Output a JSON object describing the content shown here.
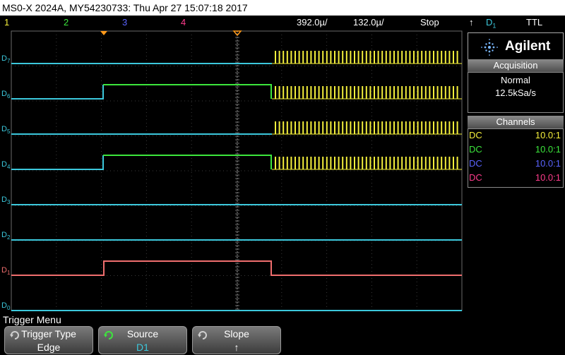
{
  "title_bar": {
    "text": "MS0-X 2024A, MY54230733: Thu Apr 27 15:07:18 2017"
  },
  "status_bar": {
    "channels": [
      {
        "label": "1",
        "color": "#f5f03c"
      },
      {
        "label": "2",
        "color": "#3ce63c"
      },
      {
        "label": "3",
        "color": "#5a64ff"
      },
      {
        "label": "4",
        "color": "#ff3c8c"
      }
    ],
    "timebase": "392.0µ/",
    "delay": "132.0µ/",
    "run_state": "Stop",
    "trigger_source": "D",
    "trigger_source_sub": "1",
    "trigger_level": "TTL"
  },
  "digital_labels": [
    {
      "name": "D",
      "sub": "7",
      "color": "#3cc8dc"
    },
    {
      "name": "D",
      "sub": "6",
      "color": "#3cc8dc"
    },
    {
      "name": "D",
      "sub": "5",
      "color": "#3cc8dc"
    },
    {
      "name": "D",
      "sub": "4",
      "color": "#3cc8dc"
    },
    {
      "name": "D",
      "sub": "3",
      "color": "#3cc8dc"
    },
    {
      "name": "D",
      "sub": "2",
      "color": "#3cc8dc"
    },
    {
      "name": "D",
      "sub": "1",
      "color": "#f06e6e"
    },
    {
      "name": "D",
      "sub": "0",
      "color": "#3cc8dc"
    }
  ],
  "brand": {
    "name": "Agilent"
  },
  "acquisition": {
    "header": "Acquisition",
    "mode": "Normal",
    "sample_rate": "12.5kSa/s"
  },
  "channels_panel": {
    "header": "Channels",
    "rows": [
      {
        "coupling": "DC",
        "probe": "10.0:1",
        "color": "#f5f03c"
      },
      {
        "coupling": "DC",
        "probe": "10.0:1",
        "color": "#3ce63c"
      },
      {
        "coupling": "DC",
        "probe": "10.0:1",
        "color": "#5a64ff"
      },
      {
        "coupling": "DC",
        "probe": "10.0:1",
        "color": "#ff3c8c"
      }
    ]
  },
  "menu": {
    "title": "Trigger Menu",
    "softkeys": [
      {
        "label": "Trigger Type",
        "value": "Edge"
      },
      {
        "label": "Source",
        "value": "D1"
      },
      {
        "label": "Slope",
        "value": "↑"
      }
    ]
  },
  "colors": {
    "cyan": "#3cc8dc",
    "green": "#3ce63c",
    "yellow": "#f5f03c",
    "red": "#f06e6e",
    "grid": "#7a7a7a"
  }
}
